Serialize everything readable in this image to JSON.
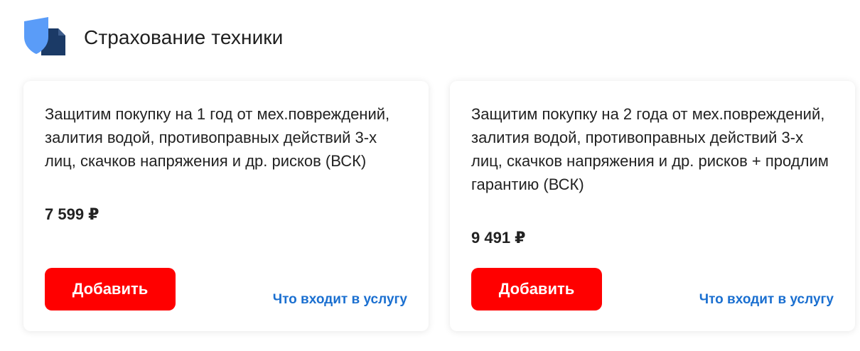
{
  "section": {
    "title": "Страхование техники",
    "icon": "insurance-shield-document-icon",
    "colors": {
      "shield": "#5a9cf8",
      "document": "#1b3a66"
    }
  },
  "cards": [
    {
      "description": "Защитим покупку на 1 год от мех.повреждений, залития водой, противоправных действий 3-х лиц, скачков напряжения и др. рисков (ВСК)",
      "price": "7 599 ₽",
      "add_label": "Добавить",
      "info_link": "Что входит в услугу"
    },
    {
      "description": "Защитим покупку на 2 года от мех.повреждений, залития водой, противоправных действий 3-х лиц, скачков напряжения и др. рисков + продлим гарантию (ВСК)",
      "price": "9 491 ₽",
      "add_label": "Добавить",
      "info_link": "Что входит в услугу"
    }
  ],
  "colors": {
    "accent": "#ff0000",
    "link": "#1a6fd0",
    "text": "#222222"
  }
}
